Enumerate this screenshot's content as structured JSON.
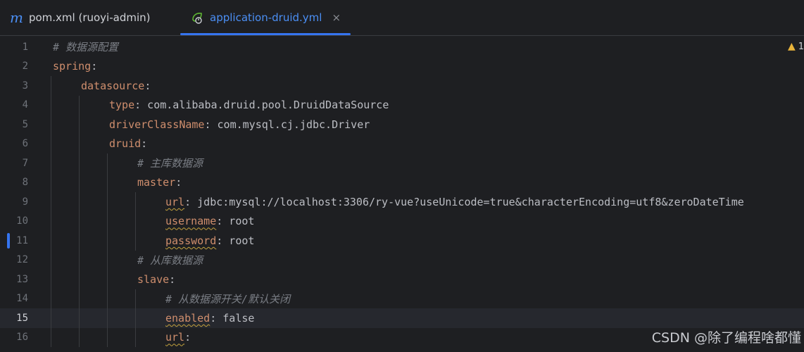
{
  "tabs": {
    "pom_icon": "m",
    "pom_label": "pom.xml (ruoyi-admin)",
    "active_label": "application-druid.yml",
    "close_glyph": "×"
  },
  "editor": {
    "warning_count": "1",
    "current_line": 15,
    "lines": [
      {
        "n": "1",
        "comment": "# 数据源配置"
      },
      {
        "n": "2",
        "key": "spring",
        "punct": ":"
      },
      {
        "n": "3",
        "key": "datasource",
        "punct": ":"
      },
      {
        "n": "4",
        "key": "type",
        "punct": ":",
        "value": " com.alibaba.druid.pool.DruidDataSource"
      },
      {
        "n": "5",
        "key": "driverClassName",
        "punct": ":",
        "value": " com.mysql.cj.jdbc.Driver"
      },
      {
        "n": "6",
        "key": "druid",
        "punct": ":"
      },
      {
        "n": "7",
        "comment": "# 主库数据源"
      },
      {
        "n": "8",
        "key": "master",
        "punct": ":"
      },
      {
        "n": "9",
        "key": "url",
        "punct": ":",
        "value": " jdbc:mysql://localhost:3306/ry-vue?useUnicode=true&characterEncoding=utf8&zeroDateTime"
      },
      {
        "n": "10",
        "key": "username",
        "punct": ":",
        "value": " root"
      },
      {
        "n": "11",
        "key": "password",
        "punct": ":",
        "value": " root"
      },
      {
        "n": "12",
        "comment": "# 从库数据源"
      },
      {
        "n": "13",
        "key": "slave",
        "punct": ":"
      },
      {
        "n": "14",
        "comment": "# 从数据源开关/默认关闭"
      },
      {
        "n": "15",
        "key": "enabled",
        "punct": ":",
        "value": " false"
      },
      {
        "n": "16",
        "key": "url",
        "punct": ":"
      }
    ]
  },
  "watermark": "CSDN @除了编程啥都懂"
}
